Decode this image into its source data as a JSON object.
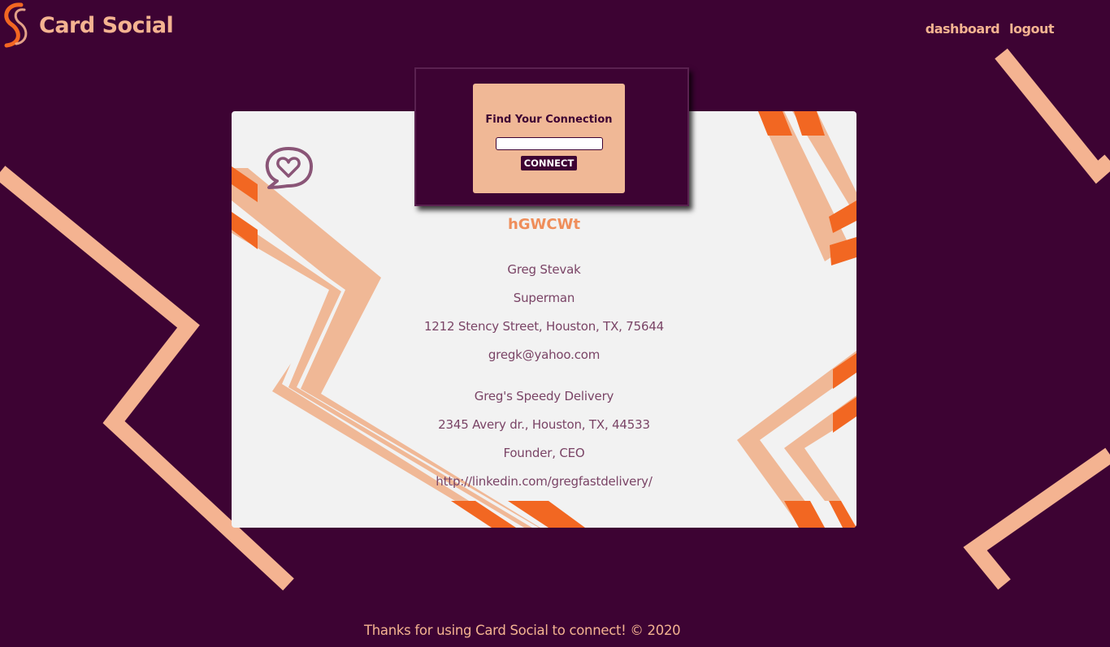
{
  "brand": {
    "name": "Card Social",
    "logo_icon": "card-social-logo"
  },
  "nav": {
    "dashboard": "dashboard",
    "logout": "logout"
  },
  "connect": {
    "title": "Find Your Connection",
    "input_value": "",
    "button": "CONNECT"
  },
  "card": {
    "code": "hGWCWt",
    "personal": {
      "name": "Greg Stevak",
      "title": "Superman",
      "address": "1212 Stency Street, Houston, TX, 75644",
      "email": "gregk@yahoo.com"
    },
    "business": {
      "company": "Greg's Speedy Delivery",
      "address": "2345 Avery dr., Houston, TX, 44533",
      "role": "Founder, CEO",
      "link": "http://linkedin.com/gregfastdelivery/"
    },
    "icon": "chat-heart-icon"
  },
  "footer": {
    "text": "Thanks for using Card Social to connect! © 2020"
  },
  "colors": {
    "background": "#3d0333",
    "accent_peach": "#f4b391",
    "accent_orange": "#f26722",
    "card_bg": "#f2f2f2",
    "text_plum": "#7a4466"
  }
}
